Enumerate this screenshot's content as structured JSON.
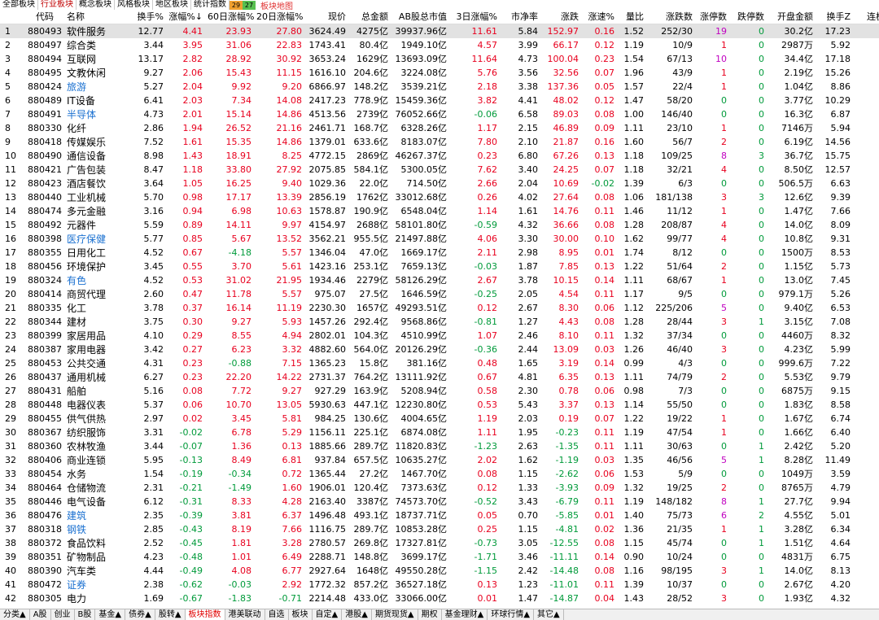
{
  "top_tabs": [
    "全部板块",
    "行业板块",
    "概念板块",
    "风格板块",
    "地区板块",
    "统计指数"
  ],
  "active_top_tab": 1,
  "up_count": "29",
  "down_count": "27",
  "map_link": "板块地图",
  "columns": [
    "",
    "代码",
    "名称",
    "换手%",
    "涨幅%↓",
    "60日涨幅%",
    "20日涨幅%",
    "现价",
    "总金额",
    "AB股总市值",
    "3日涨幅%",
    "市净率",
    "涨跌",
    "涨速%",
    "量比",
    "涨跌数",
    "涨停数",
    "跌停数",
    "开盘金额",
    "换手Z",
    "连板"
  ],
  "bottom_tabs": [
    "分类▲",
    "A股",
    "创业",
    "B股",
    "基金▲",
    "债券▲",
    "股转▲",
    "板块指数",
    "港美联动",
    "自选",
    "板块",
    "自定▲",
    "港股▲",
    "期货现货▲",
    "期权",
    "基金理财▲",
    "环球行情▲",
    "其它▲"
  ],
  "active_bottom_tab": 7,
  "colors": {
    "up": "#e8001e",
    "down": "#009a3a",
    "highlight": "#1a70d0",
    "limit_up": "#c000c0"
  },
  "rows": [
    [
      "1",
      "880493",
      "软件服务",
      "12.77",
      "4.41",
      "23.93",
      "27.80",
      "3624.49",
      "4275亿",
      "39937.96亿",
      "11.61",
      "5.84",
      "152.97",
      "0.16",
      "1.52",
      "252/30",
      "19",
      "0",
      "30.2亿",
      "17.23"
    ],
    [
      "2",
      "880497",
      "综合类",
      "3.44",
      "3.95",
      "31.06",
      "22.83",
      "1743.41",
      "80.4亿",
      "1949.10亿",
      "4.57",
      "3.99",
      "66.17",
      "0.12",
      "1.19",
      "10/9",
      "1",
      "0",
      "2987万",
      "5.92"
    ],
    [
      "3",
      "880494",
      "互联网",
      "13.17",
      "2.82",
      "28.92",
      "30.92",
      "3653.24",
      "1629亿",
      "13693.09亿",
      "11.64",
      "4.73",
      "100.04",
      "0.23",
      "1.54",
      "67/13",
      "10",
      "0",
      "34.4亿",
      "17.18"
    ],
    [
      "4",
      "880495",
      "文教休闲",
      "9.27",
      "2.06",
      "15.43",
      "11.15",
      "1616.10",
      "204.6亿",
      "3224.08亿",
      "5.76",
      "3.56",
      "32.56",
      "0.07",
      "1.96",
      "43/9",
      "1",
      "0",
      "2.19亿",
      "15.26"
    ],
    [
      "5",
      "880424",
      "旅游",
      "5.27",
      "2.04",
      "9.92",
      "9.20",
      "6866.97",
      "148.2亿",
      "3539.21亿",
      "2.18",
      "3.38",
      "137.36",
      "0.05",
      "1.57",
      "22/4",
      "1",
      "0",
      "1.04亿",
      "8.86"
    ],
    [
      "6",
      "880489",
      "IT设备",
      "6.41",
      "2.03",
      "7.34",
      "14.08",
      "2417.23",
      "778.9亿",
      "15459.36亿",
      "3.82",
      "4.41",
      "48.02",
      "0.12",
      "1.47",
      "58/20",
      "0",
      "0",
      "3.77亿",
      "10.29"
    ],
    [
      "7",
      "880491",
      "半导体",
      "4.73",
      "2.01",
      "15.14",
      "14.86",
      "4513.56",
      "2739亿",
      "76052.66亿",
      "-0.06",
      "6.58",
      "89.03",
      "0.08",
      "1.00",
      "146/40",
      "0",
      "0",
      "16.3亿",
      "6.87"
    ],
    [
      "8",
      "880330",
      "化纤",
      "2.86",
      "1.94",
      "26.52",
      "21.16",
      "2461.71",
      "168.7亿",
      "6328.26亿",
      "1.17",
      "2.15",
      "46.89",
      "0.09",
      "1.11",
      "23/10",
      "1",
      "0",
      "7146万",
      "5.94"
    ],
    [
      "9",
      "880418",
      "传媒娱乐",
      "7.52",
      "1.61",
      "15.35",
      "14.86",
      "1379.01",
      "633.6亿",
      "8183.07亿",
      "7.80",
      "2.10",
      "21.87",
      "0.16",
      "1.60",
      "56/7",
      "2",
      "0",
      "6.19亿",
      "14.56"
    ],
    [
      "10",
      "880490",
      "通信设备",
      "8.98",
      "1.43",
      "18.91",
      "8.25",
      "4772.15",
      "2869亿",
      "46267.37亿",
      "0.23",
      "6.80",
      "67.26",
      "0.13",
      "1.18",
      "109/25",
      "8",
      "3",
      "36.7亿",
      "15.75"
    ],
    [
      "11",
      "880421",
      "广告包装",
      "8.47",
      "1.18",
      "33.80",
      "27.92",
      "2075.85",
      "584.1亿",
      "5300.05亿",
      "7.62",
      "3.40",
      "24.25",
      "0.07",
      "1.18",
      "32/21",
      "4",
      "0",
      "8.50亿",
      "12.57"
    ],
    [
      "12",
      "880423",
      "酒店餐饮",
      "3.64",
      "1.05",
      "16.25",
      "9.40",
      "1029.36",
      "22.0亿",
      "714.50亿",
      "2.66",
      "2.04",
      "10.69",
      "-0.02",
      "1.39",
      "6/3",
      "0",
      "0",
      "506.5万",
      "6.63"
    ],
    [
      "13",
      "880440",
      "工业机械",
      "5.70",
      "0.98",
      "17.17",
      "13.39",
      "2856.19",
      "1762亿",
      "33012.68亿",
      "0.26",
      "4.02",
      "27.64",
      "0.08",
      "1.06",
      "181/138",
      "3",
      "3",
      "12.6亿",
      "9.39"
    ],
    [
      "14",
      "880474",
      "多元金融",
      "3.16",
      "0.94",
      "6.98",
      "10.63",
      "1578.87",
      "190.9亿",
      "6548.04亿",
      "1.14",
      "1.61",
      "14.76",
      "0.11",
      "1.46",
      "11/12",
      "1",
      "0",
      "1.47亿",
      "7.66"
    ],
    [
      "15",
      "880492",
      "元器件",
      "5.59",
      "0.89",
      "14.11",
      "9.97",
      "4154.97",
      "2688亿",
      "58101.80亿",
      "-0.59",
      "4.32",
      "36.66",
      "0.08",
      "1.28",
      "208/87",
      "4",
      "0",
      "14.0亿",
      "8.09"
    ],
    [
      "16",
      "880398",
      "医疗保健",
      "5.77",
      "0.85",
      "5.67",
      "13.52",
      "3562.21",
      "955.5亿",
      "21497.88亿",
      "4.06",
      "3.30",
      "30.00",
      "0.10",
      "1.62",
      "99/77",
      "4",
      "0",
      "10.8亿",
      "9.31"
    ],
    [
      "17",
      "880355",
      "日用化工",
      "4.52",
      "0.67",
      "-4.18",
      "5.57",
      "1346.04",
      "47.0亿",
      "1669.17亿",
      "2.11",
      "2.98",
      "8.95",
      "0.01",
      "1.74",
      "8/12",
      "0",
      "0",
      "1500万",
      "8.53"
    ],
    [
      "18",
      "880456",
      "环境保护",
      "3.45",
      "0.55",
      "3.70",
      "5.61",
      "1423.16",
      "253.1亿",
      "7659.13亿",
      "-0.03",
      "1.87",
      "7.85",
      "0.13",
      "1.22",
      "51/64",
      "2",
      "0",
      "1.15亿",
      "5.73"
    ],
    [
      "19",
      "880324",
      "有色",
      "4.52",
      "0.53",
      "31.02",
      "21.95",
      "1934.46",
      "2279亿",
      "58126.29亿",
      "2.67",
      "3.78",
      "10.15",
      "0.14",
      "1.11",
      "68/67",
      "1",
      "0",
      "13.0亿",
      "7.45"
    ],
    [
      "20",
      "880414",
      "商贸代理",
      "2.60",
      "0.47",
      "11.78",
      "5.57",
      "975.07",
      "27.5亿",
      "1646.59亿",
      "-0.25",
      "2.05",
      "4.54",
      "0.11",
      "1.17",
      "9/5",
      "0",
      "0",
      "979.1万",
      "5.26"
    ],
    [
      "21",
      "880335",
      "化工",
      "3.78",
      "0.37",
      "16.14",
      "11.19",
      "2230.30",
      "1657亿",
      "49293.51亿",
      "0.12",
      "2.67",
      "8.30",
      "0.06",
      "1.12",
      "225/206",
      "5",
      "0",
      "9.40亿",
      "6.53"
    ],
    [
      "22",
      "880344",
      "建材",
      "3.75",
      "0.30",
      "9.27",
      "5.93",
      "1457.26",
      "292.4亿",
      "9568.86亿",
      "-0.81",
      "1.27",
      "4.43",
      "0.08",
      "1.28",
      "28/44",
      "3",
      "1",
      "3.15亿",
      "7.08"
    ],
    [
      "23",
      "880399",
      "家居用品",
      "4.10",
      "0.29",
      "8.55",
      "4.94",
      "2802.01",
      "104.3亿",
      "4510.99亿",
      "1.07",
      "2.46",
      "8.10",
      "0.11",
      "1.32",
      "37/34",
      "0",
      "0",
      "4460万",
      "8.32"
    ],
    [
      "24",
      "880387",
      "家用电器",
      "3.42",
      "0.27",
      "6.23",
      "3.32",
      "4882.60",
      "564.0亿",
      "20126.29亿",
      "-0.36",
      "2.44",
      "13.09",
      "0.03",
      "1.26",
      "46/40",
      "3",
      "0",
      "4.23亿",
      "5.99"
    ],
    [
      "25",
      "880453",
      "公共交通",
      "4.31",
      "0.23",
      "-0.88",
      "7.15",
      "1365.23",
      "15.8亿",
      "381.16亿",
      "0.48",
      "1.65",
      "3.19",
      "0.14",
      "0.99",
      "4/3",
      "0",
      "0",
      "999.6万",
      "7.22"
    ],
    [
      "26",
      "880437",
      "通用机械",
      "6.27",
      "0.23",
      "22.20",
      "14.22",
      "2731.37",
      "764.2亿",
      "13111.92亿",
      "0.67",
      "4.81",
      "6.35",
      "0.13",
      "1.11",
      "74/79",
      "2",
      "0",
      "5.53亿",
      "9.79"
    ],
    [
      "27",
      "880431",
      "船舶",
      "5.16",
      "0.08",
      "7.72",
      "9.27",
      "927.29",
      "163.9亿",
      "5208.94亿",
      "0.58",
      "2.30",
      "0.78",
      "0.06",
      "0.98",
      "7/3",
      "0",
      "0",
      "6875万",
      "9.15"
    ],
    [
      "28",
      "880448",
      "电器仪表",
      "5.37",
      "0.06",
      "10.70",
      "13.05",
      "5930.63",
      "447.1亿",
      "12230.80亿",
      "0.53",
      "5.43",
      "3.37",
      "0.13",
      "1.14",
      "55/50",
      "0",
      "0",
      "1.83亿",
      "8.58"
    ],
    [
      "29",
      "880455",
      "供气供热",
      "2.97",
      "0.02",
      "3.45",
      "5.81",
      "984.25",
      "130.6亿",
      "4004.65亿",
      "1.19",
      "2.03",
      "0.19",
      "0.07",
      "1.22",
      "19/22",
      "1",
      "0",
      "1.67亿",
      "6.74"
    ],
    [
      "30",
      "880367",
      "纺织服饰",
      "3.31",
      "-0.02",
      "6.78",
      "5.29",
      "1156.11",
      "225.1亿",
      "6874.08亿",
      "1.11",
      "1.95",
      "-0.23",
      "0.11",
      "1.19",
      "47/54",
      "1",
      "0",
      "1.66亿",
      "6.40"
    ],
    [
      "31",
      "880360",
      "农林牧渔",
      "3.44",
      "-0.07",
      "1.36",
      "0.13",
      "1885.66",
      "289.7亿",
      "11820.83亿",
      "-1.23",
      "2.63",
      "-1.35",
      "0.11",
      "1.11",
      "30/63",
      "0",
      "1",
      "2.42亿",
      "5.20"
    ],
    [
      "32",
      "880406",
      "商业连锁",
      "5.95",
      "-0.13",
      "8.49",
      "6.81",
      "937.84",
      "657.5亿",
      "10635.27亿",
      "2.02",
      "1.62",
      "-1.19",
      "0.03",
      "1.35",
      "46/56",
      "5",
      "1",
      "8.28亿",
      "11.49"
    ],
    [
      "33",
      "880454",
      "水务",
      "1.54",
      "-0.19",
      "-0.34",
      "0.72",
      "1365.44",
      "27.2亿",
      "1467.70亿",
      "0.08",
      "1.15",
      "-2.62",
      "0.06",
      "1.53",
      "5/9",
      "0",
      "0",
      "1049万",
      "3.59"
    ],
    [
      "34",
      "880464",
      "仓储物流",
      "2.31",
      "-0.21",
      "-1.49",
      "1.60",
      "1906.01",
      "120.4亿",
      "7373.63亿",
      "0.12",
      "1.33",
      "-3.93",
      "0.09",
      "1.32",
      "19/25",
      "2",
      "0",
      "8765万",
      "4.79"
    ],
    [
      "35",
      "880446",
      "电气设备",
      "6.12",
      "-0.31",
      "8.33",
      "4.28",
      "2163.40",
      "3387亿",
      "74573.70亿",
      "-0.52",
      "3.43",
      "-6.79",
      "0.11",
      "1.19",
      "148/182",
      "8",
      "1",
      "27.7亿",
      "9.94"
    ],
    [
      "36",
      "880476",
      "建筑",
      "2.35",
      "-0.39",
      "3.81",
      "6.37",
      "1496.48",
      "493.1亿",
      "18737.71亿",
      "0.05",
      "0.70",
      "-5.85",
      "0.01",
      "1.40",
      "75/73",
      "6",
      "2",
      "4.55亿",
      "5.01"
    ],
    [
      "37",
      "880318",
      "钢铁",
      "2.85",
      "-0.43",
      "8.19",
      "7.66",
      "1116.75",
      "289.7亿",
      "10853.28亿",
      "0.25",
      "1.15",
      "-4.81",
      "0.02",
      "1.36",
      "21/35",
      "1",
      "1",
      "3.28亿",
      "6.34"
    ],
    [
      "38",
      "880372",
      "食品饮料",
      "2.52",
      "-0.45",
      "1.81",
      "3.28",
      "2780.57",
      "269.8亿",
      "17327.81亿",
      "-0.73",
      "3.05",
      "-12.55",
      "0.08",
      "1.15",
      "45/74",
      "0",
      "1",
      "1.51亿",
      "4.64"
    ],
    [
      "39",
      "880351",
      "矿物制品",
      "4.23",
      "-0.48",
      "1.01",
      "6.49",
      "2288.71",
      "148.8亿",
      "3699.17亿",
      "-1.71",
      "3.46",
      "-11.11",
      "0.14",
      "0.90",
      "10/24",
      "0",
      "0",
      "4831万",
      "6.75"
    ],
    [
      "40",
      "880390",
      "汽车类",
      "4.44",
      "-0.49",
      "4.08",
      "6.77",
      "2927.64",
      "1648亿",
      "49550.28亿",
      "-1.15",
      "2.42",
      "-14.48",
      "0.08",
      "1.16",
      "98/195",
      "3",
      "1",
      "14.0亿",
      "8.13"
    ],
    [
      "41",
      "880472",
      "证券",
      "2.38",
      "-0.62",
      "-0.03",
      "2.92",
      "1772.32",
      "857.2亿",
      "36527.18亿",
      "0.13",
      "1.23",
      "-11.01",
      "0.11",
      "1.39",
      "10/37",
      "0",
      "0",
      "2.67亿",
      "4.20"
    ],
    [
      "42",
      "880305",
      "电力",
      "1.69",
      "-0.67",
      "-1.83",
      "-0.71",
      "2214.48",
      "433.0亿",
      "33066.00亿",
      "0.01",
      "1.47",
      "-14.87",
      "0.04",
      "1.43",
      "28/52",
      "3",
      "0",
      "1.93亿",
      "4.32"
    ]
  ],
  "highlighted_names": [
    "旅游",
    "半导体",
    "医疗保健",
    "有色",
    "证券",
    "建筑",
    "钢铁"
  ],
  "selected_row": 0
}
